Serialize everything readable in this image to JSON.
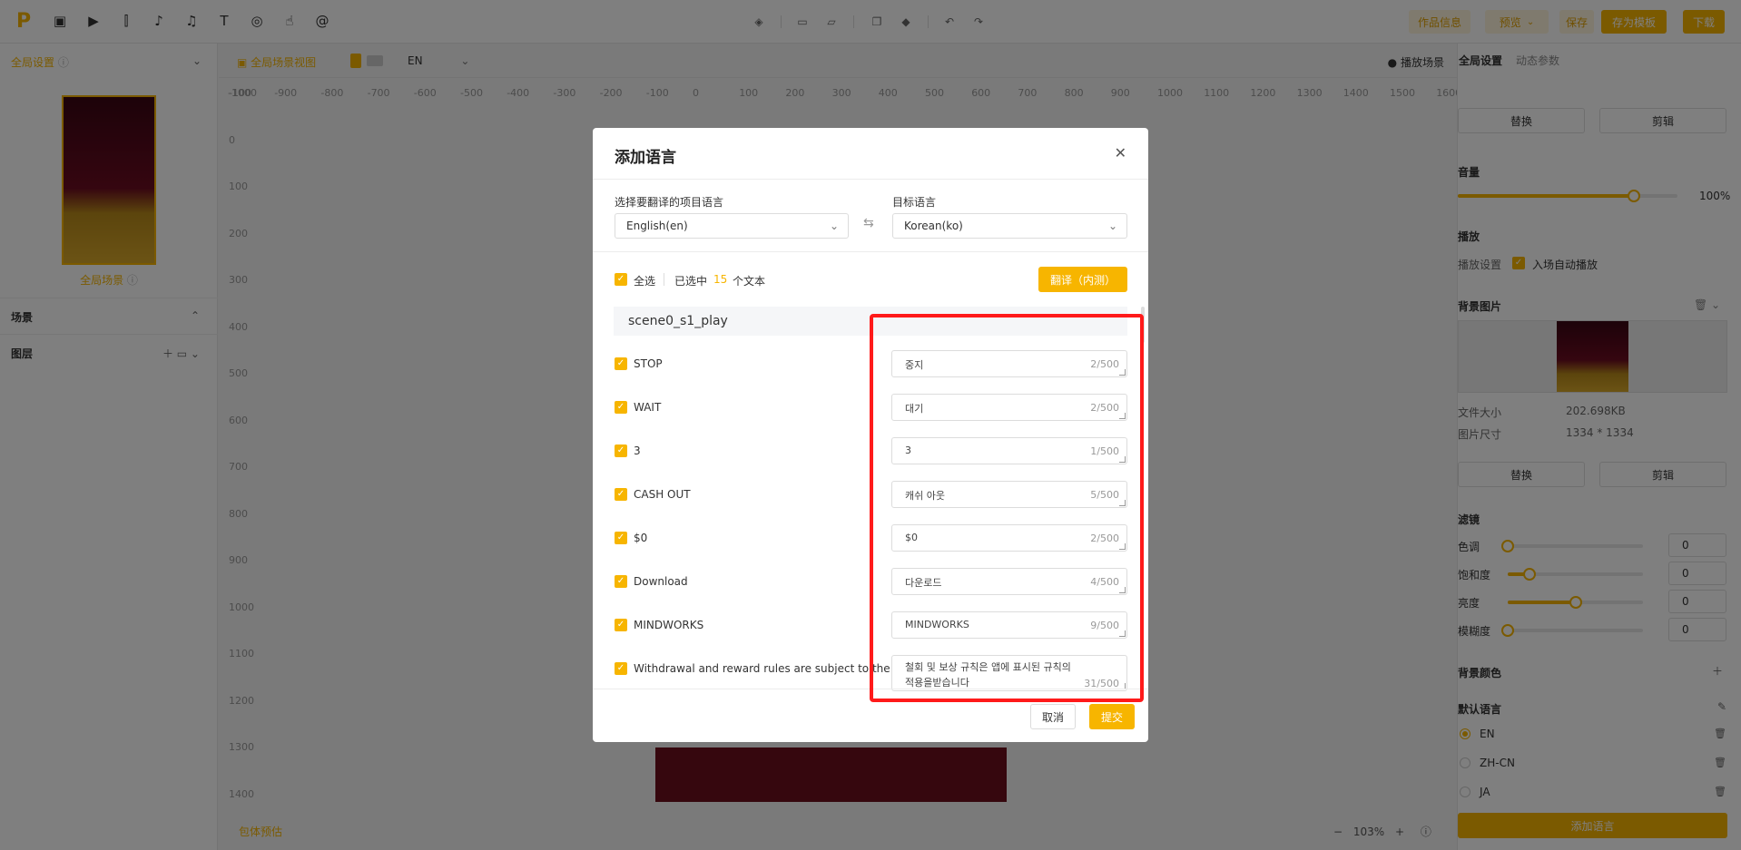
{
  "topbar": {
    "logo": "P",
    "buttons": {
      "work_info": "作品信息",
      "preview": "预览",
      "save": "保存",
      "save_template": "存为模板",
      "download": "下载"
    }
  },
  "left_panel": {
    "global_settings": "全局设置",
    "scene_label": "全局场景",
    "scenes_title": "场景",
    "layers_title": "图层"
  },
  "canvas": {
    "scene_view": "全局场景视图",
    "lang": "EN",
    "play_scene": "播放场景",
    "ruler_top": [
      "-1000",
      "-900",
      "-800",
      "-700",
      "-600",
      "-500",
      "-400",
      "-300",
      "-200",
      "-100",
      "0",
      "100",
      "200",
      "300",
      "400",
      "500",
      "600",
      "700",
      "800",
      "900",
      "1000",
      "1100",
      "1200",
      "1300",
      "1400",
      "1500",
      "1600"
    ],
    "ruler_left": [
      "-100",
      "0",
      "100",
      "200",
      "300",
      "400",
      "500",
      "600",
      "700",
      "800",
      "900",
      "1000",
      "1100",
      "1200",
      "1300",
      "1400"
    ],
    "package_preview": "包体预估",
    "zoom": "103%"
  },
  "right_panel": {
    "tab_global": "全局设置",
    "tab_dynamic": "动态参数",
    "replace": "替换",
    "crop": "剪辑",
    "volume_title": "音量",
    "volume_value": "100%",
    "volume_level": 0.8,
    "play_title": "播放",
    "play_setting": "播放设置",
    "autoplay": "入场自动播放",
    "bg_image_title": "背景图片",
    "file_size_label": "文件大小",
    "file_size": "202.698KB",
    "image_size_label": "图片尺寸",
    "image_size": "1334 * 1334",
    "filter_title": "滤镜",
    "filters": [
      {
        "label": "色调",
        "value": "0",
        "level": 0.0
      },
      {
        "label": "饱和度",
        "value": "0",
        "level": 0.16
      },
      {
        "label": "亮度",
        "value": "0",
        "level": 0.5
      },
      {
        "label": "模糊度",
        "value": "0",
        "level": 0.0
      }
    ],
    "bg_color_title": "背景颜色",
    "default_lang_title": "默认语言",
    "languages": [
      "EN",
      "ZH-CN",
      "JA"
    ],
    "add_language": "添加语言"
  },
  "modal": {
    "title": "添加语言",
    "source_label": "选择要翻译的项目语言",
    "source_value": "English(en)",
    "target_label": "目标语言",
    "target_value": "Korean(ko)",
    "select_all": "全选",
    "selected_prefix": "已选中",
    "selected_count": "15",
    "selected_suffix": "个文本",
    "translate_button": "翻译（内测）",
    "scene_name": "scene0_s1_play",
    "items": [
      {
        "source": "STOP",
        "target": "중지",
        "count": "2/500"
      },
      {
        "source": "WAIT",
        "target": "대기",
        "count": "2/500"
      },
      {
        "source": "3",
        "target": "3",
        "count": "1/500"
      },
      {
        "source": "CASH OUT",
        "target": "캐쉬 아웃",
        "count": "5/500"
      },
      {
        "source": "$0",
        "target": "$0",
        "count": "2/500"
      },
      {
        "source": "Download",
        "target": "다운로드",
        "count": "4/500"
      },
      {
        "source": "MINDWORKS",
        "target": "MINDWORKS",
        "count": "9/500"
      },
      {
        "source": "Withdrawal and reward rules are subject to the",
        "target": "철회 및 보상 규칙은 앱에 표시된 규칙의 적용을받습니다",
        "count": "31/500"
      }
    ],
    "cancel": "取消",
    "submit": "提交"
  },
  "colors": {
    "accent": "#f7b500",
    "highlight": "#ff1a1a"
  }
}
